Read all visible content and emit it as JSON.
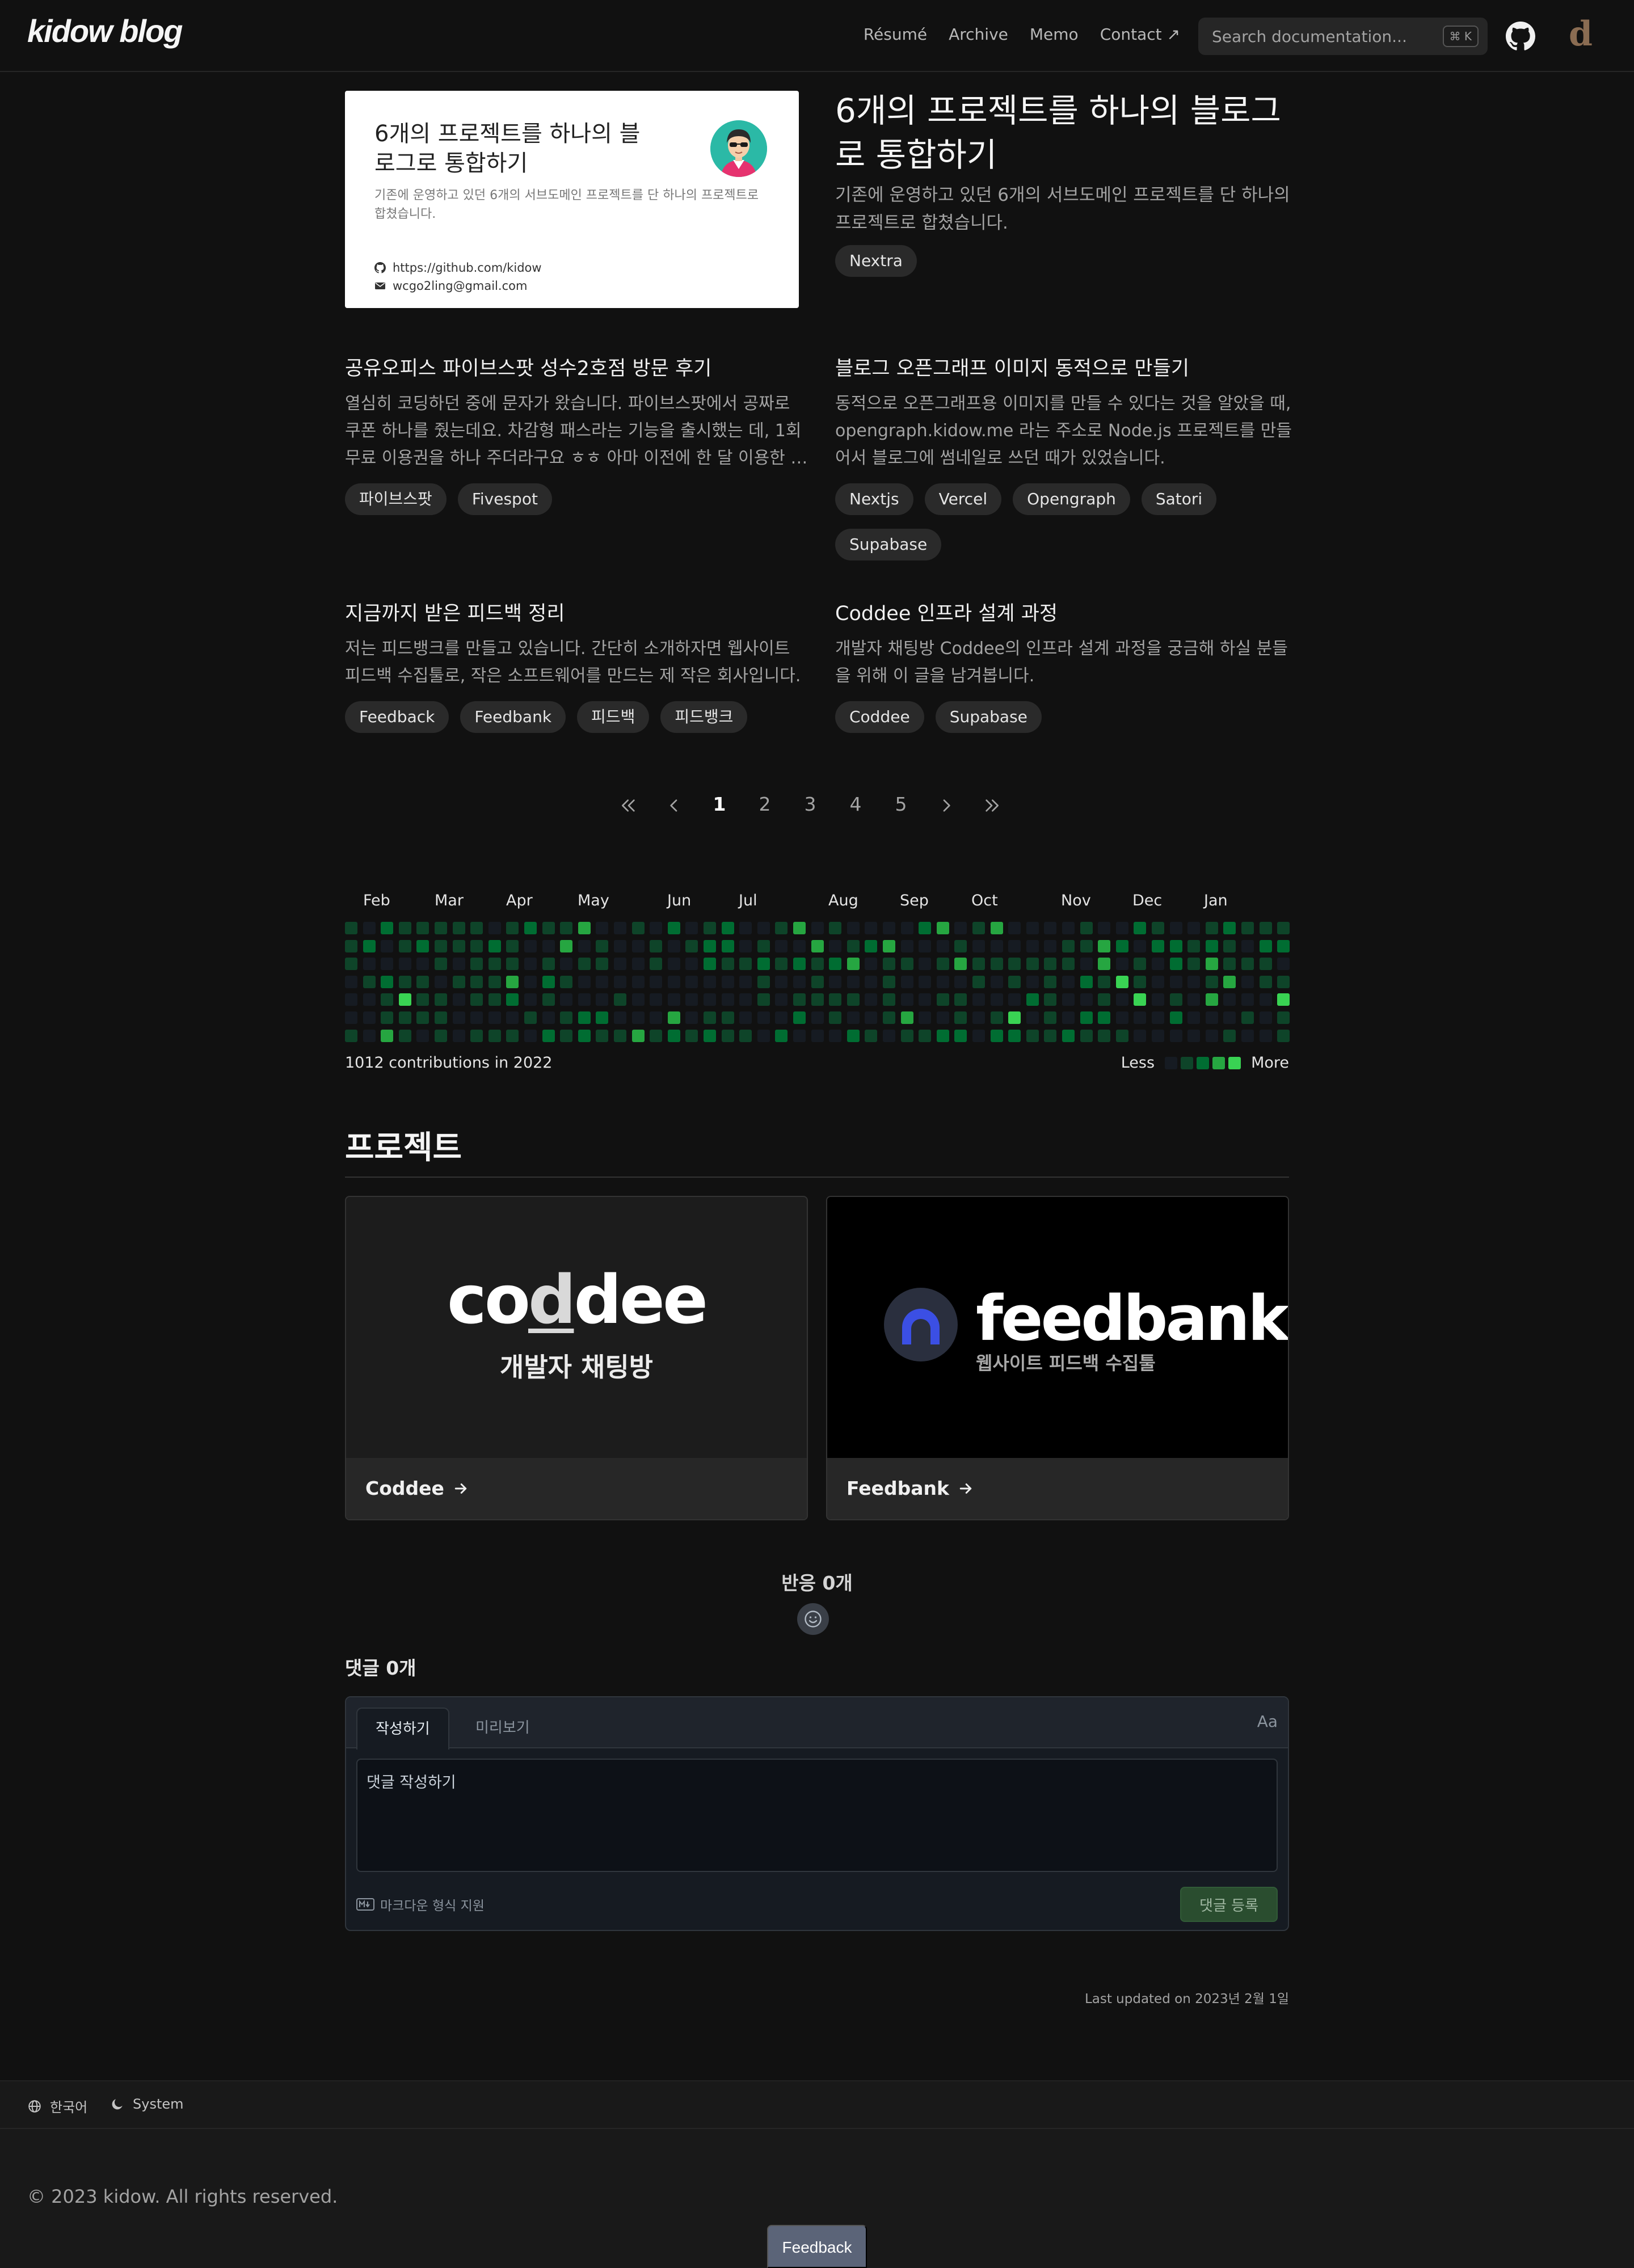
{
  "header": {
    "logo": "kidow blog",
    "nav": [
      "Résumé",
      "Archive",
      "Memo",
      "Contact ↗"
    ],
    "search_placeholder": "Search documentation...",
    "search_shortcut": "⌘ K",
    "avatar_letter": "d"
  },
  "featured": {
    "og_title": "6개의 프로젝트를 하나의 블로그로 통합하기",
    "og_desc": "기존에 운영하고 있던 6개의 서브도메인 프로젝트를 단 하나의 프로젝트로 합쳤습니다.",
    "og_github": "https://github.com/kidow",
    "og_email": "wcgo2ling@gmail.com",
    "title": "6개의 프로젝트를 하나의 블로그로 통합하기",
    "desc": "기존에 운영하고 있던 6개의 서브도메인 프로젝트를 단 하나의 프로젝트로 합쳤습니다.",
    "tags": [
      "Nextra"
    ]
  },
  "posts": [
    {
      "title": "공유오피스 파이브스팟 성수2호점 방문 후기",
      "desc": "열심히 코딩하던 중에 문자가 왔습니다. 파이브스팟에서 공짜로 쿠폰 하나를 줬는데요. 차감형 패스라는 기능을 출시했는 데, 1회 무료 이용권을 하나 주더라구요 ㅎㅎ 아마 이전에 한 달 이용한 적이 있어서인 것 같습니다.",
      "tags": [
        "파이브스팟",
        "Fivespot"
      ]
    },
    {
      "title": "블로그 오픈그래프 이미지 동적으로 만들기",
      "desc": "동적으로 오픈그래프용 이미지를 만들 수 있다는 것을 알았을 때, opengraph.kidow.me 라는 주소로 Node.js 프로젝트를 만들어서 블로그에 썸네일로 쓰던 때가 있었습니다.",
      "tags": [
        "Nextjs",
        "Vercel",
        "Opengraph",
        "Satori",
        "Supabase"
      ]
    },
    {
      "title": "지금까지 받은 피드백 정리",
      "desc": "저는 피드뱅크를 만들고 있습니다. 간단히 소개하자면 웹사이트 피드백 수집툴로, 작은 소프트웨어를 만드는 제 작은 회사입니다.",
      "tags": [
        "Feedback",
        "Feedbank",
        "피드백",
        "피드뱅크"
      ]
    },
    {
      "title": "Coddee 인프라 설계 과정",
      "desc": "개발자 채팅방 Coddee의 인프라 설계 과정을 궁금해 하실 분들을 위해 이 글을 남겨봅니다.",
      "tags": [
        "Coddee",
        "Supabase"
      ]
    }
  ],
  "pagination": {
    "pages": [
      "1",
      "2",
      "3",
      "4",
      "5"
    ],
    "current": "1"
  },
  "contributions": {
    "months": [
      "Feb",
      "Mar",
      "Apr",
      "May",
      "Jun",
      "Jul",
      "Aug",
      "Sep",
      "Oct",
      "Nov",
      "Dec",
      "Jan"
    ],
    "total": "1012 contributions in 2022",
    "less": "Less",
    "more": "More",
    "colors": [
      "#161b22",
      "#0e4429",
      "#006d32",
      "#26a641",
      "#39d353"
    ]
  },
  "projects": {
    "title": "프로젝트",
    "items": [
      {
        "name": "Coddee",
        "logo_word": "coddee",
        "subtitle": "개발자 채팅방"
      },
      {
        "name": "Feedbank",
        "logo_word": "feedbank",
        "subtitle": "웹사이트 피드백 수집툴"
      }
    ]
  },
  "reactions": {
    "title": "반응 0개"
  },
  "comments": {
    "title": "댓글 0개",
    "tab_write": "작성하기",
    "tab_preview": "미리보기",
    "aa": "Aa",
    "placeholder": "댓글 작성하기",
    "markdown_hint": "마크다운 형식 지원",
    "submit": "댓글 등록"
  },
  "last_updated": "Last updated on 2023년 2월 1일",
  "footer": {
    "language": "한국어",
    "theme": "System",
    "copyright": "© 2023 kidow. All rights reserved.",
    "feedback": "Feedback"
  }
}
